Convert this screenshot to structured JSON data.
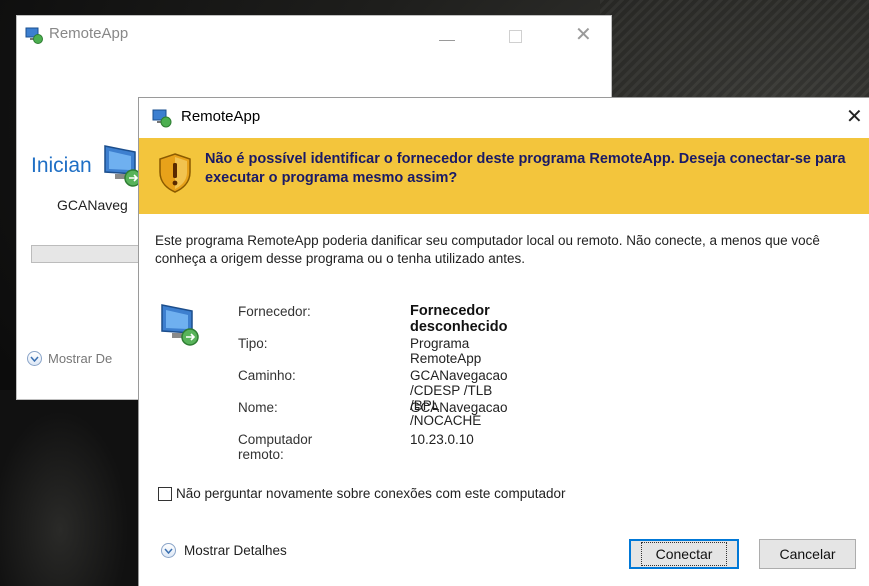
{
  "background_window": {
    "title": "RemoteApp",
    "status_text": "Inician",
    "app_name": "GCANaveg",
    "details_label": "Mostrar De"
  },
  "dialog": {
    "title": "RemoteApp",
    "warning": "Não é possível identificar o fornecedor deste programa RemoteApp. Deseja conectar-se para executar o programa mesmo assim?",
    "description": "Este programa RemoteApp poderia danificar seu computador local ou remoto. Não conecte, a menos que você conheça a origem desse programa ou o tenha utilizado antes.",
    "info": [
      {
        "label": "Fornecedor:",
        "value": "Fornecedor desconhecido"
      },
      {
        "label": "Tipo:",
        "value": "Programa RemoteApp"
      },
      {
        "label": "Caminho:",
        "value": "GCANavegacao /CDESP /TLB /BPL /NOCACHE"
      },
      {
        "label": "Nome:",
        "value": "GCANavegacao"
      },
      {
        "label": "Computador remoto:",
        "value": "10.23.0.10"
      }
    ],
    "checkbox_label": "Não perguntar novamente sobre conexões com este computador",
    "checkbox_checked": false,
    "details_label": "Mostrar Detalhes",
    "connect_label": "Conectar",
    "cancel_label": "Cancelar"
  },
  "colors": {
    "warning_bar": "#f3c53c",
    "warning_text": "#1a1a66",
    "accent": "#0078d7"
  },
  "icons": [
    "remoteapp-icon",
    "monitor-icon",
    "shield-warning-icon",
    "chevron-down-icon",
    "close-icon",
    "minimize-icon",
    "maximize-icon"
  ]
}
